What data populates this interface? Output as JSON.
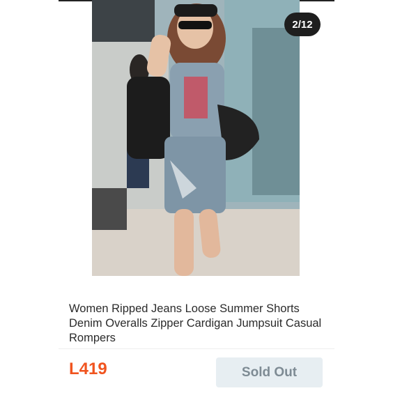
{
  "gallery": {
    "image_alt_name": "product-photo",
    "counter": "2/12"
  },
  "product": {
    "title": "Women Ripped Jeans Loose Summer Shorts Denim Overalls Zipper Cardigan Jumpsuit Casual Rompers",
    "price": "L419",
    "status_button": "Sold Out"
  },
  "colors": {
    "price": "#f0541f",
    "counter_bg": "#1e1e1e",
    "sold_out_bg": "#e7eef2",
    "sold_out_text": "#7e8b94"
  }
}
